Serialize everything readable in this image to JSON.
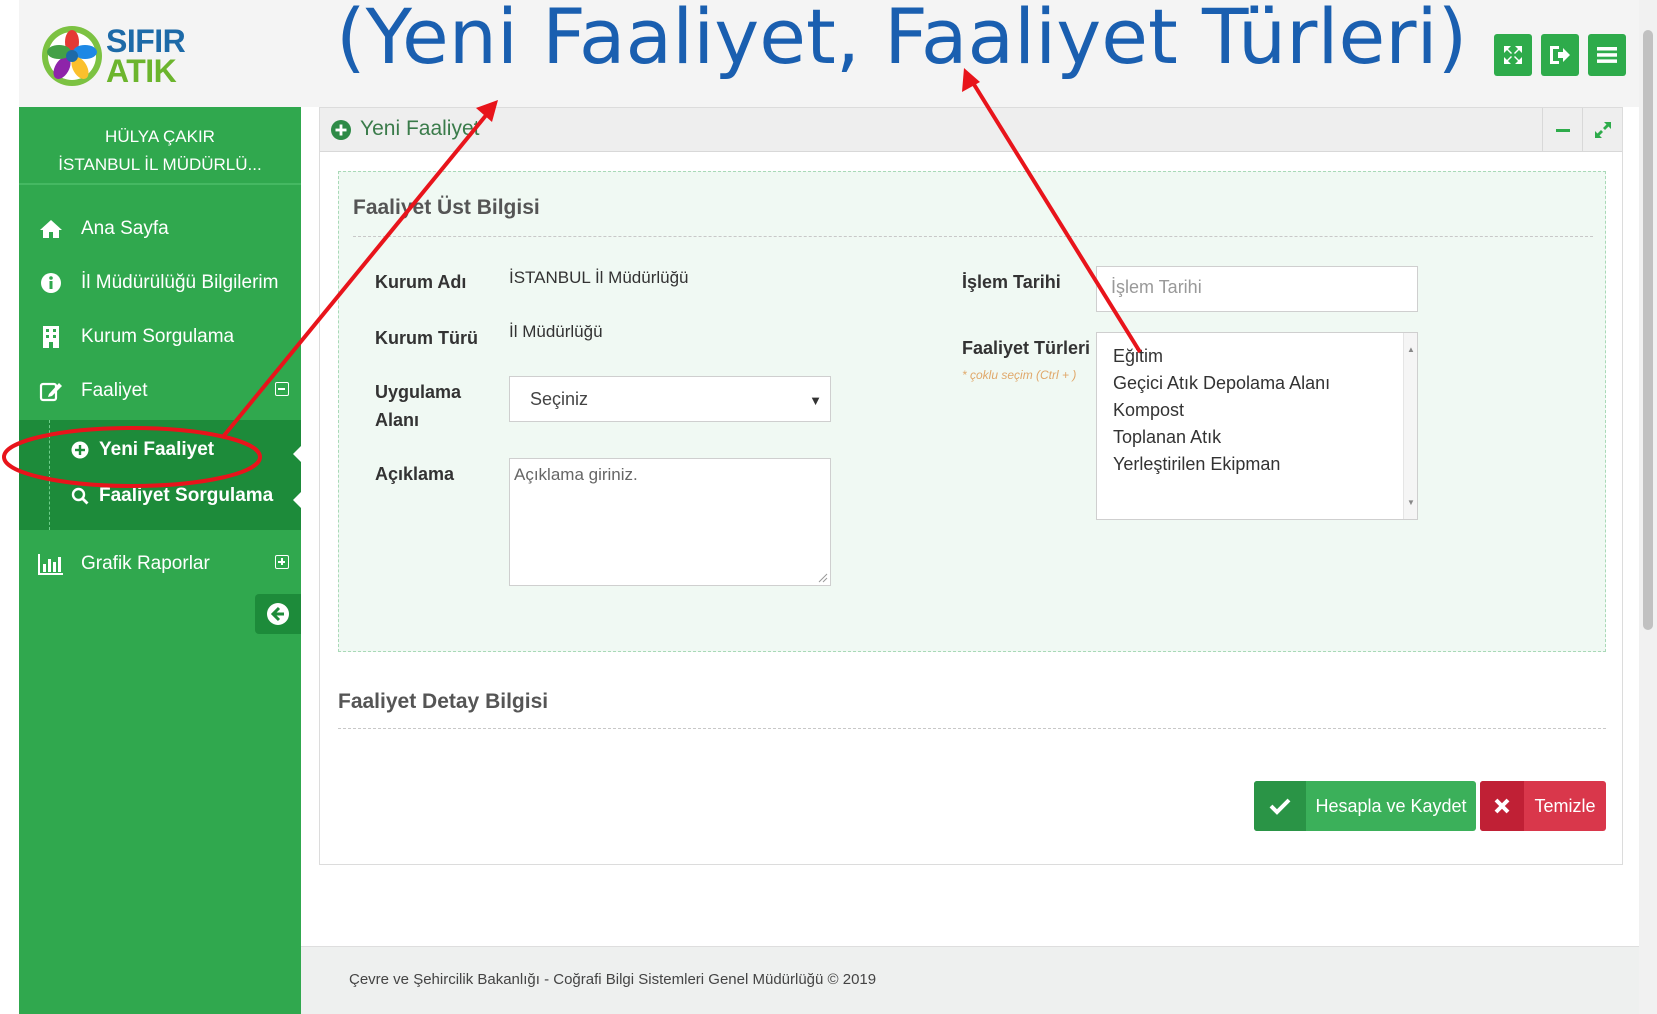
{
  "logo": {
    "line1": "SIFIR",
    "line2": "ATIK"
  },
  "annotation_title": "(Yeni Faaliyet, Faaliyet Türleri)",
  "user": {
    "name": "HÜLYA ÇAKIR",
    "org": "İSTANBUL İL MÜDÜRLÜ..."
  },
  "sidebar": {
    "items": [
      {
        "label": "Ana Sayfa",
        "icon": "home-icon"
      },
      {
        "label": "İl Müdürülüğü Bilgilerim",
        "icon": "info-icon"
      },
      {
        "label": "Kurum Sorgulama",
        "icon": "building-icon"
      },
      {
        "label": "Faaliyet",
        "icon": "edit-icon"
      },
      {
        "label": "Grafik Raporlar",
        "icon": "bar-chart-icon"
      }
    ],
    "sub_items": [
      {
        "label": "Yeni Faaliyet",
        "icon": "plus-circle-icon"
      },
      {
        "label": "Faaliyet Sorgulama",
        "icon": "search-icon"
      }
    ]
  },
  "panel": {
    "title": "Yeni Faaliyet"
  },
  "form": {
    "section1_title": "Faaliyet Üst Bilgisi",
    "kurum_adi_label": "Kurum Adı",
    "kurum_adi_value": "İSTANBUL İl Müdürlüğü",
    "kurum_turu_label": "Kurum Türü",
    "kurum_turu_value": "İl Müdürlüğü",
    "uygulama_label_1": "Uygulama",
    "uygulama_label_2": "Alanı",
    "uygulama_selected": "Seçiniz",
    "aciklama_label": "Açıklama",
    "aciklama_placeholder": "Açıklama giriniz.",
    "islem_tarihi_label": "İşlem Tarihi",
    "islem_tarihi_placeholder": "İşlem Tarihi",
    "faaliyet_turleri_label": "Faaliyet Türleri",
    "faaliyet_turleri_hint": "* çoklu seçim (Ctrl + )",
    "faaliyet_turleri_options": [
      "Eğitim",
      "Geçici Atık Depolama Alanı",
      "Kompost",
      "Toplanan Atık",
      "Yerleştirilen Ekipman"
    ],
    "section2_title": "Faaliyet Detay Bilgisi"
  },
  "buttons": {
    "save": "Hesapla ve Kaydet",
    "clear": "Temizle"
  },
  "footer": "Çevre ve Şehircilik Bakanlığı - Coğrafi Bilgi Sistemleri Genel Müdürlüğü © 2019",
  "colors": {
    "sidebar": "#30a84e",
    "sidebar_active": "#1d8b3a",
    "annotation": "#e8141b",
    "title": "#1a5fb0",
    "danger": "#d9374b"
  }
}
